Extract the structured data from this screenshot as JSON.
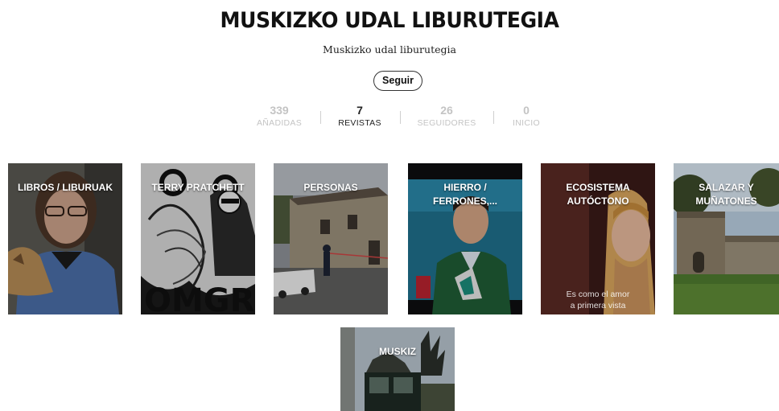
{
  "header": {
    "title": "MUSKIZKO UDAL LIBURUTEGIA",
    "subtitle": "Muskizko udal liburutegia",
    "follow_label": "Seguir"
  },
  "stats": [
    {
      "value": "339",
      "label": "AÑADIDAS",
      "active": false
    },
    {
      "value": "7",
      "label": "REVISTAS",
      "active": true
    },
    {
      "value": "26",
      "label": "SEGUIDORES",
      "active": false
    },
    {
      "value": "0",
      "label": "INICIO",
      "active": false
    }
  ],
  "magazines": [
    {
      "title": "LIBROS / LIBURUAK"
    },
    {
      "title": "TERRY PRATCHETT"
    },
    {
      "title": "PERSONAS"
    },
    {
      "title": "HIERRO / FERRONES,..."
    },
    {
      "title": "ECOSISTEMA AUTÓCTONO",
      "caption_line1": "Es como el amor",
      "caption_line2": "a primera vista"
    },
    {
      "title": "SALAZAR Y MUÑATONES"
    },
    {
      "title": "MUSKIZ"
    }
  ]
}
